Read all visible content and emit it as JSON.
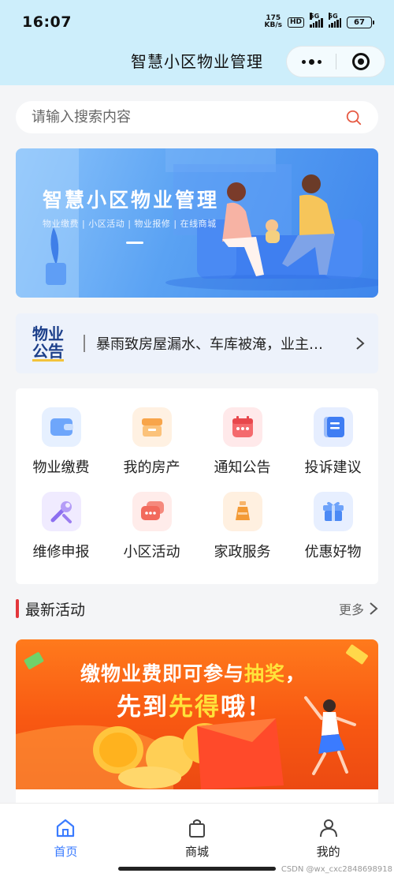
{
  "status_bar": {
    "time": "16:07",
    "net_speed_value": "175",
    "net_speed_unit": "KB/s",
    "hd_label": "HD",
    "signal1": "5G",
    "signal2": "5G",
    "battery": "67"
  },
  "nav": {
    "title": "智慧小区物业管理"
  },
  "search": {
    "placeholder": "请输入搜索内容"
  },
  "banner": {
    "title": "智慧小区物业管理",
    "subtitle": "物业缴费 | 小区活动 | 物业报修 | 在线商城"
  },
  "notice": {
    "logo_line1": "物业",
    "logo_line2": "公告",
    "text": "暴雨致房屋漏水、车库被淹，业主…"
  },
  "services": [
    {
      "label": "物业缴费",
      "icon": "wallet-icon",
      "color": "#4f8ff7"
    },
    {
      "label": "我的房产",
      "icon": "house-store-icon",
      "color": "#f7a13b"
    },
    {
      "label": "通知公告",
      "icon": "calendar-icon",
      "color": "#f0555a"
    },
    {
      "label": "投诉建议",
      "icon": "document-icon",
      "color": "#3f7df3"
    },
    {
      "label": "维修申报",
      "icon": "wrench-icon",
      "color": "#9b7df0"
    },
    {
      "label": "小区活动",
      "icon": "chat-bubble-icon",
      "color": "#f26a5c"
    },
    {
      "label": "家政服务",
      "icon": "flask-icon",
      "color": "#f39a35"
    },
    {
      "label": "优惠好物",
      "icon": "gift-icon",
      "color": "#4b89f5"
    }
  ],
  "activities": {
    "title": "最新活动",
    "more": "更多",
    "banner_pre1": "缴物业费即可参与",
    "banner_hl1": "抽奖",
    "banner_post1": "，",
    "banner_pre2": "先到",
    "banner_hl2": "先得",
    "banner_post2": "哦！"
  },
  "tabs": [
    {
      "label": "首页",
      "icon": "home-icon",
      "active": true
    },
    {
      "label": "商城",
      "icon": "shopping-bag-icon",
      "active": false
    },
    {
      "label": "我的",
      "icon": "user-icon",
      "active": false
    }
  ],
  "colors": {
    "header_bg": "#cdeefb",
    "accent": "#3a7bff",
    "section_bar": "#e3363b",
    "activity_orange": "#f85812"
  },
  "watermark": "CSDN @wx_cxc2848698918"
}
